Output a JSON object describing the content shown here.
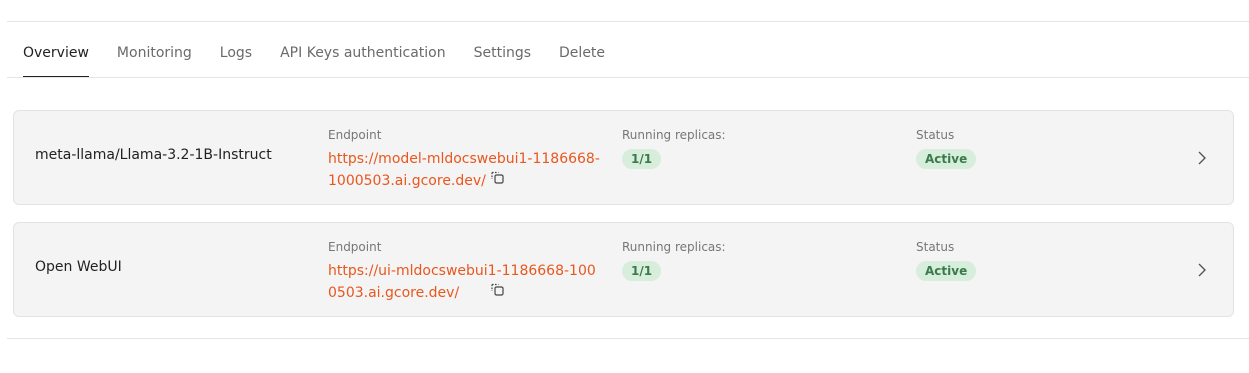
{
  "tabs": [
    {
      "label": "Overview",
      "active": true
    },
    {
      "label": "Monitoring",
      "active": false
    },
    {
      "label": "Logs",
      "active": false
    },
    {
      "label": "API Keys authentication",
      "active": false
    },
    {
      "label": "Settings",
      "active": false
    },
    {
      "label": "Delete",
      "active": false
    }
  ],
  "columns": {
    "endpoint": "Endpoint",
    "replicas": "Running replicas:",
    "status": "Status"
  },
  "deployments": [
    {
      "name": "meta-llama/Llama-3.2-1B-Instruct",
      "endpoint_url": "https://model-mldocswebui1-1186668-1000503.ai.gcore.dev/",
      "replicas": "1/1",
      "status": "Active"
    },
    {
      "name": "Open WebUI",
      "endpoint_url": "https://ui-mldocswebui1-1186668-1000503.ai.gcore.dev/",
      "replicas": "1/1",
      "status": "Active"
    }
  ],
  "icons": {
    "copy": "copy-icon",
    "chevron": "chevron-right-icon"
  },
  "colors": {
    "link": "#e8571e",
    "status_bg": "#d6eedb",
    "status_text": "#3b7a4a"
  }
}
